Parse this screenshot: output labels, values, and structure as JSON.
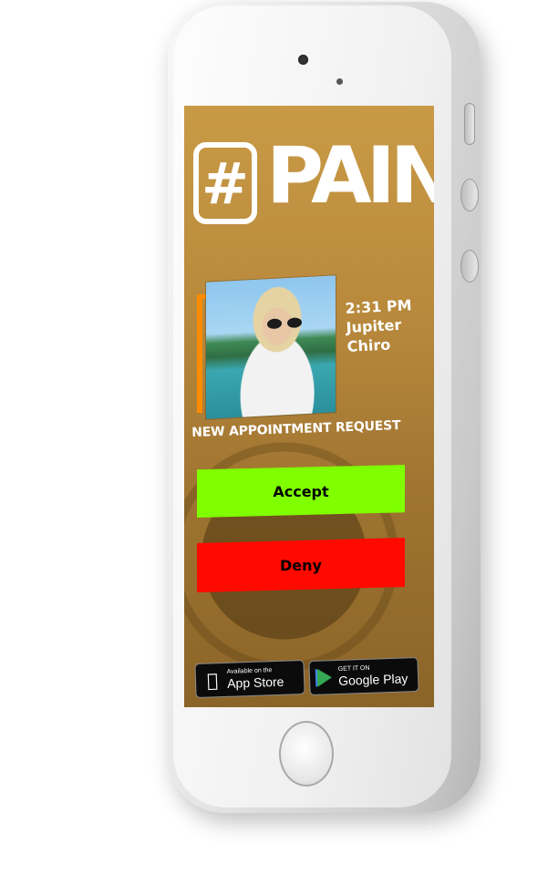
{
  "app": {
    "logo_symbol": "#",
    "logo_text": "PAIN"
  },
  "appointment": {
    "time": "2:31 PM",
    "location_line1": "Jupiter",
    "location_line2": "Chiro",
    "request_title": "NEW APPOINTMENT REQUEST"
  },
  "actions": {
    "accept_label": "Accept",
    "deny_label": "Deny"
  },
  "stores": {
    "apple_small": "Available on the",
    "apple_big": "App Store",
    "google_small": "GET IT ON",
    "google_big": "Google Play"
  },
  "icons": {
    "apple": "apple-icon",
    "google_play": "google-play-icon"
  },
  "colors": {
    "accept": "#7fff00",
    "deny": "#ff0a00",
    "photo_frame": "#ff8c00",
    "screen_background": "#b8893c"
  }
}
